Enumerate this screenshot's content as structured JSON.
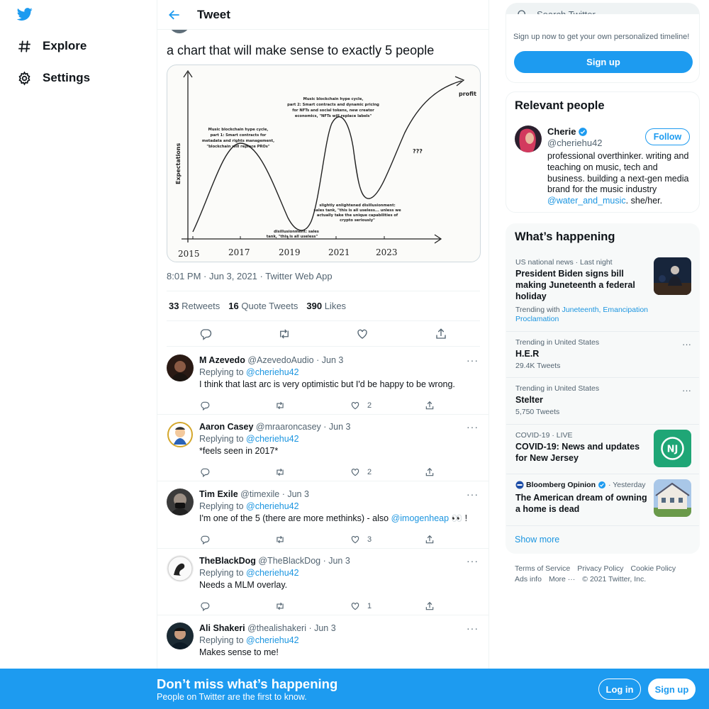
{
  "nav": {
    "logo_icon": "twitter-bird-icon",
    "items": [
      {
        "label": "Explore",
        "icon": "hashtag-icon"
      },
      {
        "label": "Settings",
        "icon": "gear-icon"
      }
    ]
  },
  "header": {
    "title": "Tweet",
    "back_icon": "arrow-left-icon"
  },
  "tweet": {
    "text": "a chart that will make sense to exactly 5 people",
    "meta": "8:01 PM · Jun 3, 2021 · Twitter Web App",
    "stats": {
      "retweets": "33",
      "retweets_label": "Retweets",
      "quotes": "16",
      "quotes_label": "Quote Tweets",
      "likes": "390",
      "likes_label": "Likes"
    },
    "image": {
      "ylabel": "Expectations",
      "years": [
        "2015",
        "2017",
        "2019",
        "2021",
        "2023"
      ],
      "profit": "profit",
      "unknown": "???",
      "ann1": [
        "Music blockchain hype cycle,",
        "part 1: Smart contracts for",
        "metadata and rights management,",
        "\"blockchain will replace PROs\""
      ],
      "ann2": [
        "Music blockchain hype cycle,",
        "part 2: Smart contracts and dynamic pricing",
        "for NFTs and social tokens, new creator",
        "economics, \"NFTs will replace labels\""
      ],
      "ann3": [
        "disillusionment: sales",
        "tank, \"this is all useless\""
      ],
      "ann4": [
        "slightly enlightened disillusionment:",
        "sales tank, \"this is all useless... unless we",
        "actually take the unique capabilities of",
        "crypto seriously\""
      ]
    }
  },
  "replies": [
    {
      "name": "M Azevedo",
      "handle": "@AzevedoAudio",
      "date": "· Jun 3",
      "replying": "Replying to",
      "to": "@cheriehu42",
      "text": "I think that last arc is very optimistic but I'd be happy to be wrong.",
      "likes": "2"
    },
    {
      "name": "Aaron Casey",
      "handle": "@mraaroncasey",
      "date": "· Jun 3",
      "replying": "Replying to",
      "to": "@cheriehu42",
      "text": "*feels seen in 2017*",
      "likes": "2"
    },
    {
      "name": "Tim Exile",
      "handle": "@timexile",
      "date": "· Jun 3",
      "replying": "Replying to",
      "to": "@cheriehu42",
      "text": "I'm one of the 5 (there are more methinks) - also",
      "mention": "@imogenheap",
      "text_end": "👀 !",
      "likes": "3"
    },
    {
      "name": "TheBlackDog",
      "handle": "@TheBlackDog",
      "date": "· Jun 3",
      "replying": "Replying to",
      "to": "@cheriehu42",
      "text": "Needs a MLM overlay.",
      "likes": "1"
    },
    {
      "name": "Ali Shakeri",
      "handle": "@thealishakeri",
      "date": "· Jun 3",
      "replying": "Replying to",
      "to": "@cheriehu42",
      "text": "Makes sense to me!"
    }
  ],
  "sidebar": {
    "search_placeholder": "Search Twitter",
    "signup_text": "Sign up now to get your own personalized timeline!",
    "signup_button": "Sign up",
    "relevant_title": "Relevant people",
    "person": {
      "name": "Cherie",
      "handle": "@cheriehu42",
      "follow": "Follow",
      "bio": "professional overthinker. writing and teaching on music, tech and business. building a next-gen media brand for the music industry",
      "bio_link": "@water_and_music",
      "bio_end": ". she/her."
    },
    "happening_title": "What’s happening",
    "trends": [
      {
        "context": "US national news · Last night",
        "title": "President Biden signs bill making Juneteenth a federal holiday",
        "sub_prefix": "Trending with",
        "sub_links": "Juneteenth, Emancipation Proclamation"
      },
      {
        "context": "Trending in United States",
        "title": "H.E.R",
        "sub": "29.4K Tweets"
      },
      {
        "context": "Trending in United States",
        "title": "Stelter",
        "sub": "5,750 Tweets"
      },
      {
        "context": "COVID-19 · LIVE",
        "title": "COVID-19: News and updates for New Jersey"
      },
      {
        "context_name": "Bloomberg Opinion",
        "context_time": "· Yesterday",
        "title": "The American dream of owning a home is dead"
      }
    ],
    "show_more": "Show more",
    "footer": {
      "links": [
        "Terms of Service",
        "Privacy Policy",
        "Cookie Policy"
      ],
      "links2": [
        "Ads info",
        "More ···"
      ],
      "copyright": "© 2021 Twitter, Inc."
    }
  },
  "banner": {
    "title": "Don’t miss what’s happening",
    "subtitle": "People on Twitter are the first to know.",
    "login": "Log in",
    "signup": "Sign up"
  },
  "colors": {
    "accent": "#1d9bf0",
    "link": "#1b95e0"
  }
}
